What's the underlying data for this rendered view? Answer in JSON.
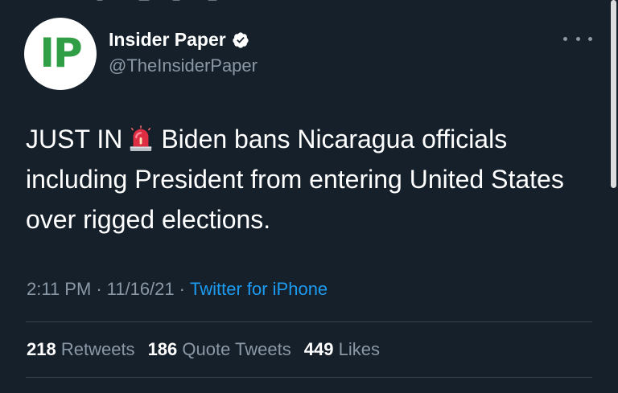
{
  "author": {
    "avatar_text": "IP",
    "name": "Insider Paper",
    "handle": "@TheInsiderPaper",
    "verified": true
  },
  "tweet": {
    "text_before_emoji": "JUST IN",
    "emoji": "rotating-light",
    "text_after_emoji": "Biden bans Nicaragua officials including President from entering United States over rigged elections."
  },
  "meta": {
    "time": "2:11 PM",
    "separator": "·",
    "date": "11/16/21",
    "source": "Twitter for iPhone"
  },
  "stats": [
    {
      "count": "218",
      "label": "Retweets"
    },
    {
      "count": "186",
      "label": "Quote Tweets"
    },
    {
      "count": "449",
      "label": "Likes"
    }
  ],
  "colors": {
    "background": "#15202b",
    "text": "#ffffff",
    "secondary_text": "#8b98a5",
    "link": "#1d9bf0",
    "verified_badge": "#ffffff",
    "avatar_letters": "#2f9e44",
    "divider": "#38444d"
  }
}
